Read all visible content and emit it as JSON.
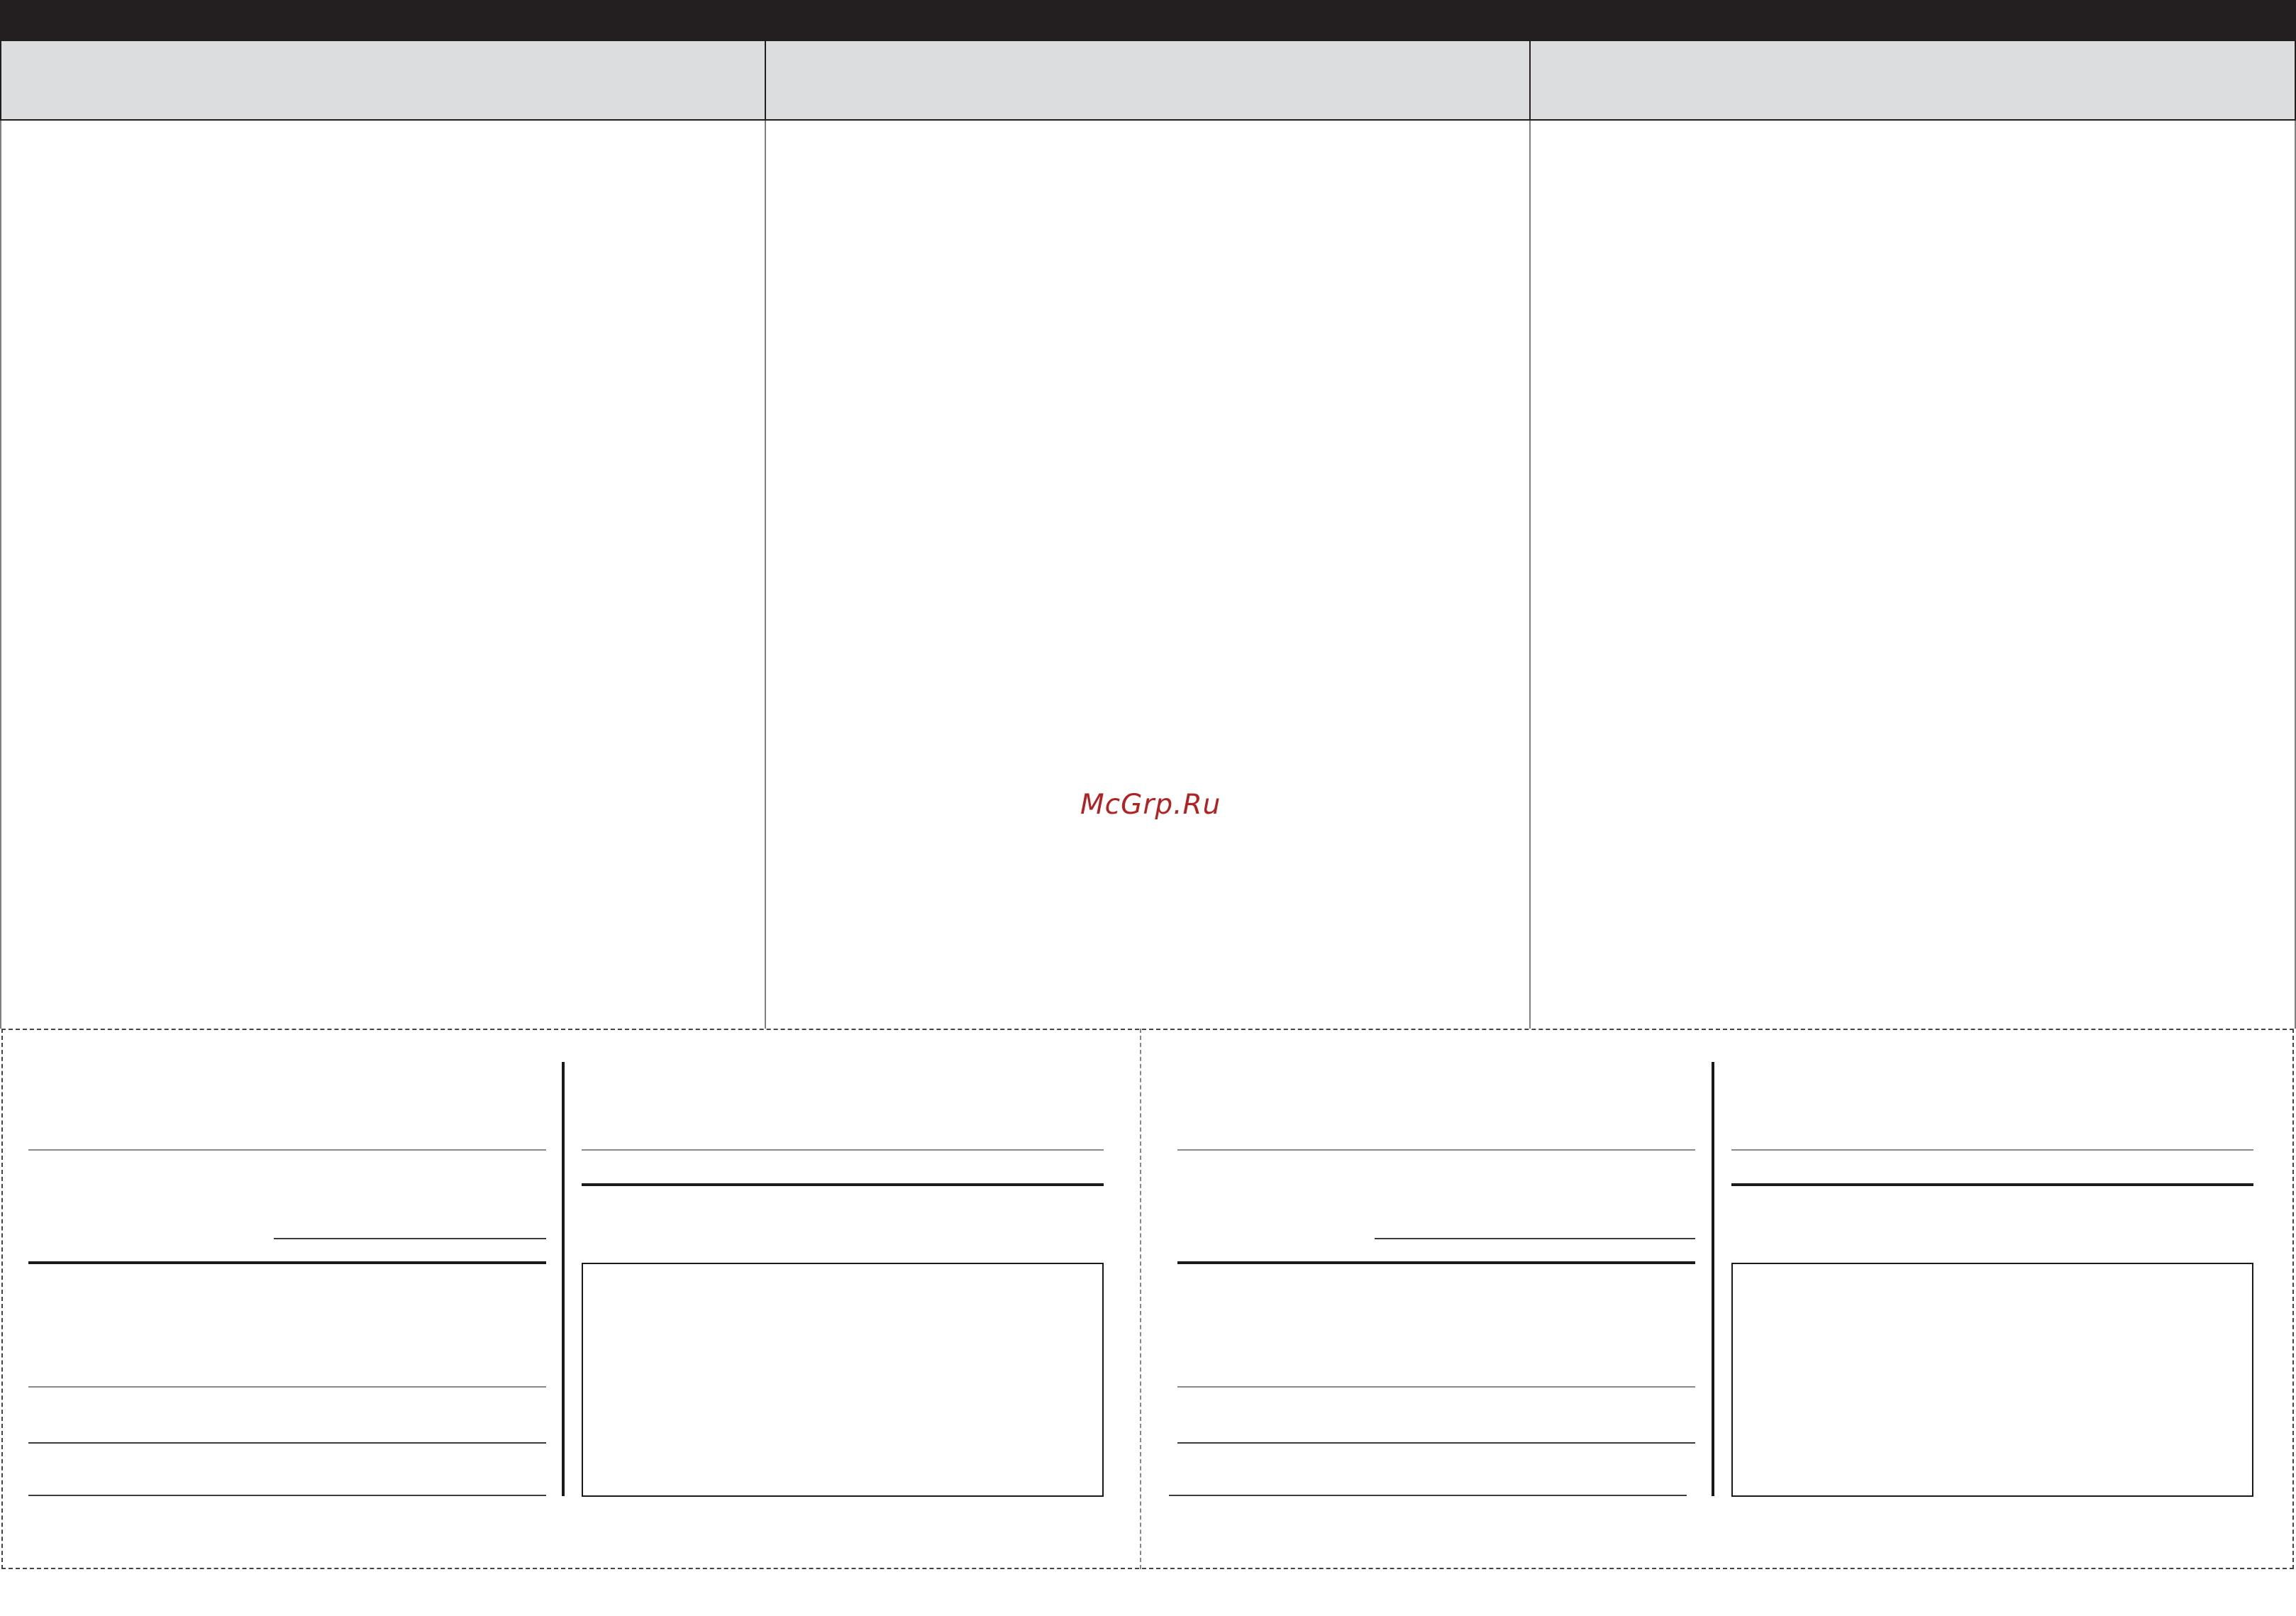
{
  "watermark": {
    "text": "McGrp.Ru",
    "color": "#b22222"
  },
  "colors": {
    "header_band": "#231f20",
    "subheader_band": "#dcdddf"
  },
  "columns": [
    {
      "header": "",
      "subheader": ""
    },
    {
      "header": "",
      "subheader": ""
    },
    {
      "header": "",
      "subheader": ""
    }
  ],
  "coupons": [
    {
      "name": ""
    },
    {
      "name": ""
    }
  ]
}
